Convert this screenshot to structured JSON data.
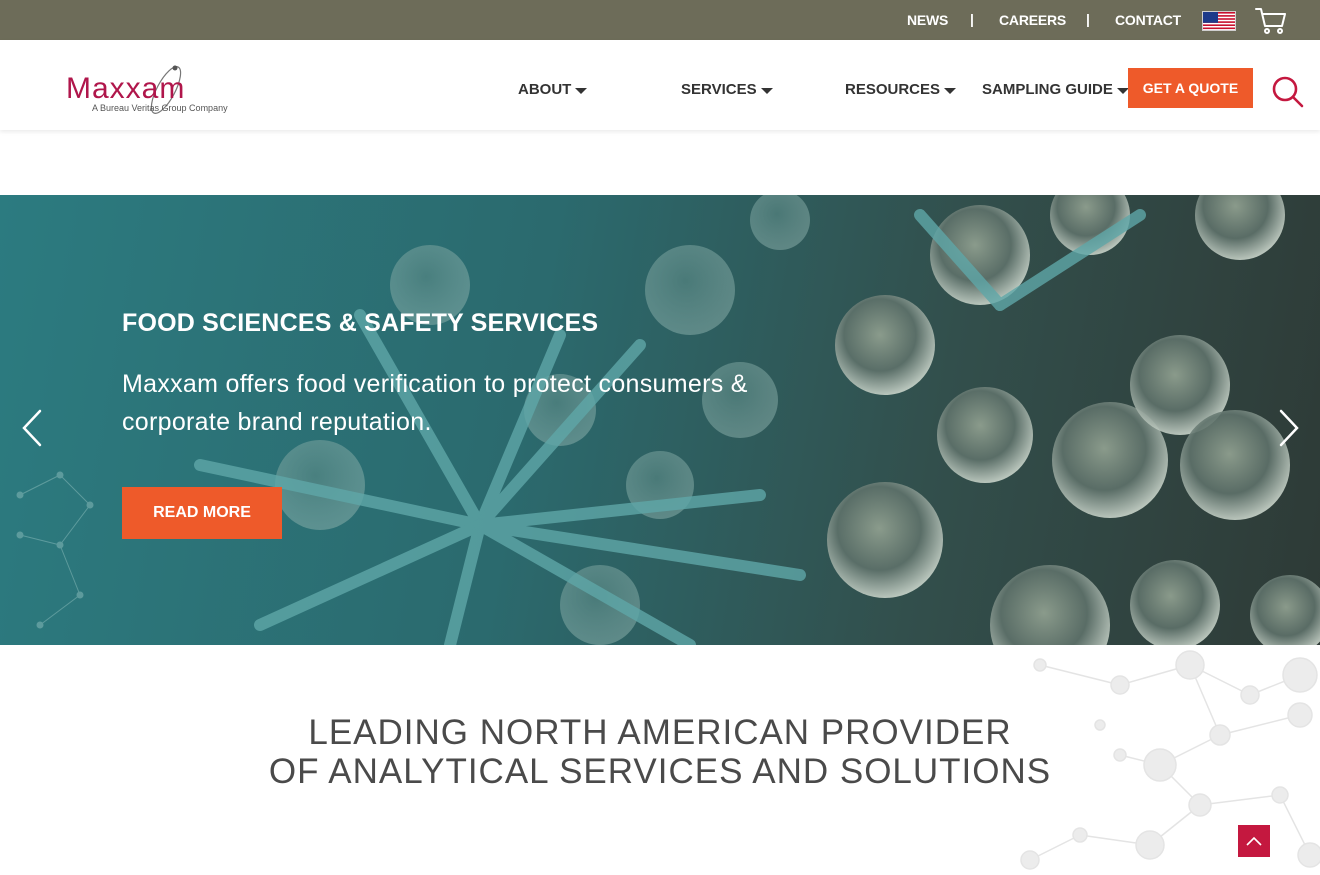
{
  "utility": {
    "links": [
      "NEWS",
      "CAREERS",
      "CONTACT"
    ],
    "separator": "|"
  },
  "logo": {
    "wordmark": "Maxxam",
    "tagline": "A Bureau Veritas Group Company"
  },
  "nav": {
    "items": [
      "ABOUT",
      "SERVICES",
      "RESOURCES",
      "SAMPLING GUIDE"
    ],
    "quote_label": "GET A QUOTE"
  },
  "hero": {
    "title": "FOOD SCIENCES & SAFETY SERVICES",
    "text": "Maxxam offers food verification to protect consumers & corporate brand reputation.",
    "cta": "READ MORE"
  },
  "intro": {
    "line1": "LEADING NORTH AMERICAN PROVIDER",
    "line2": "OF ANALYTICAL SERVICES AND SOLUTIONS"
  },
  "icons": [
    "us-flag-icon",
    "cart-icon",
    "search-icon",
    "chevron-left-icon",
    "chevron-right-icon",
    "arrow-up-icon"
  ],
  "colors": {
    "utility_bar": "#6d6c59",
    "accent_orange": "#ee5a2a",
    "brand_crimson": "#b0164b"
  }
}
